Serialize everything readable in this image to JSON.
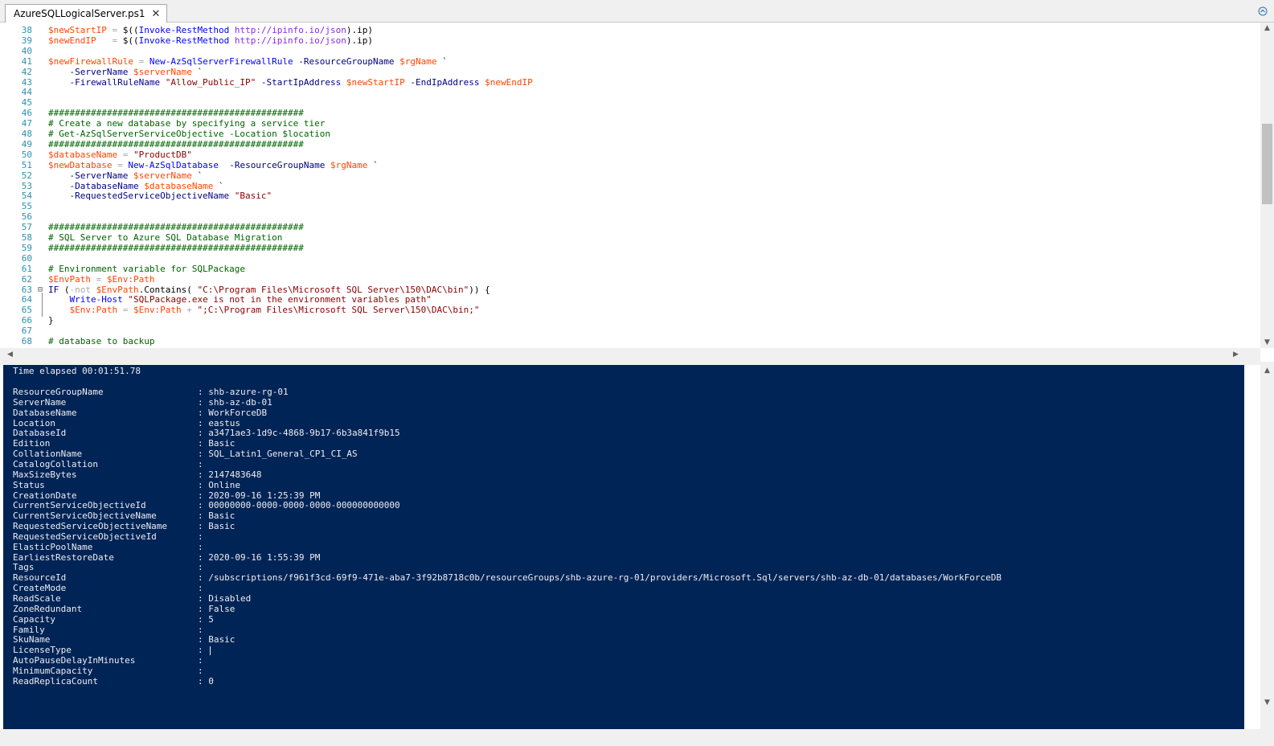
{
  "tab": {
    "title": "AzureSQLLogicalServer.ps1",
    "close_glyph": "✕"
  },
  "editor": {
    "lines": [
      {
        "n": "38",
        "fold": "",
        "t": [
          [
            "var",
            "$newStartIP"
          ],
          [
            "op",
            " = "
          ],
          [
            "prop",
            "$(("
          ],
          [
            "cmd",
            "Invoke-RestMethod"
          ],
          [
            "prop",
            " "
          ],
          [
            "url",
            "http://ipinfo.io/json"
          ],
          [
            "prop",
            ").ip)"
          ]
        ]
      },
      {
        "n": "39",
        "fold": "",
        "t": [
          [
            "var",
            "$newEndIP"
          ],
          [
            "op",
            "   = "
          ],
          [
            "prop",
            "$(("
          ],
          [
            "cmd",
            "Invoke-RestMethod"
          ],
          [
            "prop",
            " "
          ],
          [
            "url",
            "http://ipinfo.io/json"
          ],
          [
            "prop",
            ").ip)"
          ]
        ]
      },
      {
        "n": "40",
        "fold": "",
        "t": []
      },
      {
        "n": "41",
        "fold": "",
        "t": [
          [
            "var",
            "$newFirewallRule"
          ],
          [
            "op",
            " = "
          ],
          [
            "cmd",
            "New-AzSqlServerFirewallRule"
          ],
          [
            "param",
            " -ResourceGroupName "
          ],
          [
            "var",
            "$rgName"
          ],
          [
            "prop",
            " `"
          ]
        ]
      },
      {
        "n": "42",
        "fold": "",
        "t": [
          [
            "param",
            "    -ServerName "
          ],
          [
            "var",
            "$serverName"
          ],
          [
            "prop",
            " `"
          ]
        ]
      },
      {
        "n": "43",
        "fold": "",
        "t": [
          [
            "param",
            "    -FirewallRuleName "
          ],
          [
            "str",
            "\"Allow_Public_IP\""
          ],
          [
            "param",
            " -StartIpAddress "
          ],
          [
            "var",
            "$newStartIP"
          ],
          [
            "param",
            " -EndIpAddress "
          ],
          [
            "var",
            "$newEndIP"
          ]
        ]
      },
      {
        "n": "44",
        "fold": "",
        "t": []
      },
      {
        "n": "45",
        "fold": "",
        "t": []
      },
      {
        "n": "46",
        "fold": "",
        "t": [
          [
            "cmt",
            "################################################"
          ]
        ]
      },
      {
        "n": "47",
        "fold": "",
        "t": [
          [
            "cmt",
            "# Create a new database by specifying a service tier"
          ]
        ]
      },
      {
        "n": "48",
        "fold": "",
        "t": [
          [
            "cmt",
            "# Get-AzSqlServerServiceObjective -Location $location"
          ]
        ]
      },
      {
        "n": "49",
        "fold": "",
        "t": [
          [
            "cmt",
            "################################################"
          ]
        ]
      },
      {
        "n": "50",
        "fold": "",
        "t": [
          [
            "var",
            "$databaseName"
          ],
          [
            "op",
            " = "
          ],
          [
            "str",
            "\"ProductDB\""
          ]
        ]
      },
      {
        "n": "51",
        "fold": "",
        "t": [
          [
            "var",
            "$newDatabase"
          ],
          [
            "op",
            " = "
          ],
          [
            "cmd",
            "New-AzSqlDatabase"
          ],
          [
            "param",
            "  -ResourceGroupName "
          ],
          [
            "var",
            "$rgName"
          ],
          [
            "prop",
            " `"
          ]
        ]
      },
      {
        "n": "52",
        "fold": "",
        "t": [
          [
            "param",
            "    -ServerName "
          ],
          [
            "var",
            "$serverName"
          ],
          [
            "prop",
            " `"
          ]
        ]
      },
      {
        "n": "53",
        "fold": "",
        "t": [
          [
            "param",
            "    -DatabaseName "
          ],
          [
            "var",
            "$databaseName"
          ],
          [
            "prop",
            " `"
          ]
        ]
      },
      {
        "n": "54",
        "fold": "",
        "t": [
          [
            "param",
            "    -RequestedServiceObjectiveName "
          ],
          [
            "str",
            "\"Basic\""
          ]
        ]
      },
      {
        "n": "55",
        "fold": "",
        "t": []
      },
      {
        "n": "56",
        "fold": "",
        "t": []
      },
      {
        "n": "57",
        "fold": "",
        "t": [
          [
            "cmt",
            "################################################"
          ]
        ]
      },
      {
        "n": "58",
        "fold": "",
        "t": [
          [
            "cmt",
            "# SQL Server to Azure SQL Database Migration"
          ]
        ]
      },
      {
        "n": "59",
        "fold": "",
        "t": [
          [
            "cmt",
            "################################################"
          ]
        ]
      },
      {
        "n": "60",
        "fold": "",
        "t": []
      },
      {
        "n": "61",
        "fold": "",
        "t": [
          [
            "cmt",
            "# Environment variable for SQLPackage"
          ]
        ]
      },
      {
        "n": "62",
        "fold": "",
        "t": [
          [
            "var",
            "$EnvPath"
          ],
          [
            "op",
            " = "
          ],
          [
            "var",
            "$Env:Path"
          ]
        ]
      },
      {
        "n": "63",
        "fold": "⊟",
        "t": [
          [
            "kw",
            "IF"
          ],
          [
            "prop",
            " ("
          ],
          [
            "op",
            "-not"
          ],
          [
            "prop",
            " "
          ],
          [
            "var",
            "$EnvPath"
          ],
          [
            "prop",
            ".Contains( "
          ],
          [
            "str",
            "\"C:\\Program Files\\Microsoft SQL Server\\150\\DAC\\bin\""
          ],
          [
            "prop",
            ")) {"
          ]
        ]
      },
      {
        "n": "64",
        "fold": "",
        "t": [
          [
            "prop",
            "    "
          ],
          [
            "cmd",
            "Write-Host"
          ],
          [
            "prop",
            " "
          ],
          [
            "str",
            "\"SQLPackage.exe is not in the environment variables path\""
          ]
        ]
      },
      {
        "n": "65",
        "fold": "",
        "t": [
          [
            "prop",
            "    "
          ],
          [
            "var",
            "$Env:Path"
          ],
          [
            "op",
            " = "
          ],
          [
            "var",
            "$Env:Path"
          ],
          [
            "op",
            " + "
          ],
          [
            "str",
            "\";C:\\Program Files\\Microsoft SQL Server\\150\\DAC\\bin;\""
          ]
        ]
      },
      {
        "n": "66",
        "fold": "",
        "t": [
          [
            "prop",
            "}"
          ]
        ]
      },
      {
        "n": "67",
        "fold": "",
        "t": []
      },
      {
        "n": "68",
        "fold": "",
        "t": [
          [
            "cmt",
            "# database to backup"
          ]
        ]
      }
    ]
  },
  "console": {
    "header": "Time elapsed 00:01:51.78",
    "props": [
      [
        "ResourceGroupName",
        "shb-azure-rg-01"
      ],
      [
        "ServerName",
        "shb-az-db-01"
      ],
      [
        "DatabaseName",
        "WorkForceDB"
      ],
      [
        "Location",
        "eastus"
      ],
      [
        "DatabaseId",
        "a3471ae3-1d9c-4868-9b17-6b3a841f9b15"
      ],
      [
        "Edition",
        "Basic"
      ],
      [
        "CollationName",
        "SQL_Latin1_General_CP1_CI_AS"
      ],
      [
        "CatalogCollation",
        ""
      ],
      [
        "MaxSizeBytes",
        "2147483648"
      ],
      [
        "Status",
        "Online"
      ],
      [
        "CreationDate",
        "2020-09-16 1:25:39 PM"
      ],
      [
        "CurrentServiceObjectiveId",
        "00000000-0000-0000-0000-000000000000"
      ],
      [
        "CurrentServiceObjectiveName",
        "Basic"
      ],
      [
        "RequestedServiceObjectiveName",
        "Basic"
      ],
      [
        "RequestedServiceObjectiveId",
        ""
      ],
      [
        "ElasticPoolName",
        ""
      ],
      [
        "EarliestRestoreDate",
        "2020-09-16 1:55:39 PM"
      ],
      [
        "Tags",
        ""
      ],
      [
        "ResourceId",
        "/subscriptions/f961f3cd-69f9-471e-aba7-3f92b8718c0b/resourceGroups/shb-azure-rg-01/providers/Microsoft.Sql/servers/shb-az-db-01/databases/WorkForceDB"
      ],
      [
        "CreateMode",
        ""
      ],
      [
        "ReadScale",
        "Disabled"
      ],
      [
        "ZoneRedundant",
        "False"
      ],
      [
        "Capacity",
        "5"
      ],
      [
        "Family",
        ""
      ],
      [
        "SkuName",
        "Basic"
      ],
      [
        "LicenseType",
        ""
      ],
      [
        "AutoPauseDelayInMinutes",
        ""
      ],
      [
        "MinimumCapacity",
        ""
      ],
      [
        "ReadReplicaCount",
        "0"
      ]
    ]
  },
  "colors": {
    "console_bg": "#012456",
    "console_fg": "#eeedf0",
    "line_numbers": "#2b91af",
    "variable": "#ff4500",
    "cmdlet": "#0000ff",
    "comment": "#006400",
    "string": "#8b0000"
  }
}
